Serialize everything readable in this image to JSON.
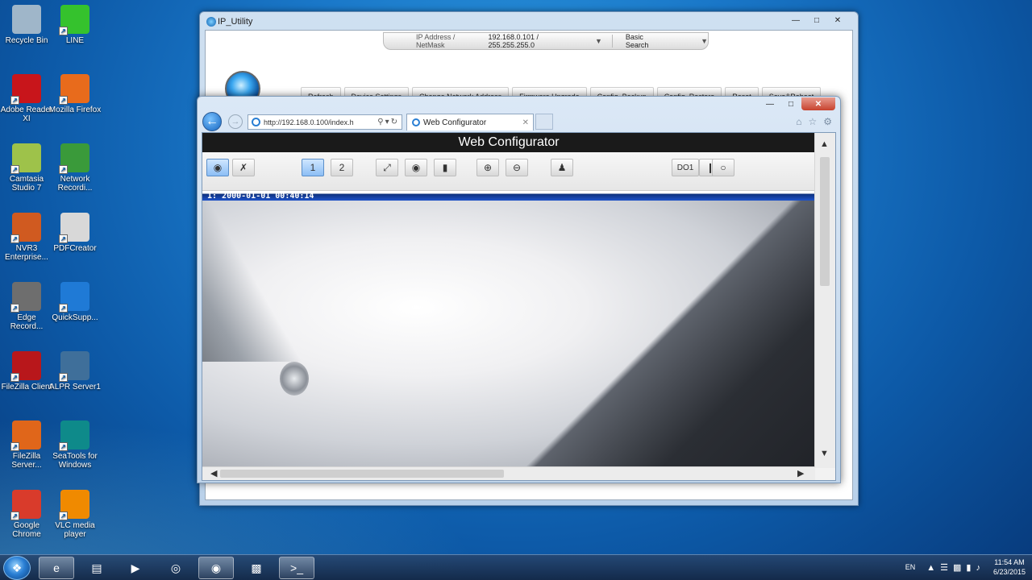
{
  "desktop": {
    "icons": [
      {
        "label": "Recycle Bin",
        "icon": "recycle-bin-icon",
        "color": "#9fb6c9"
      },
      {
        "label": "LINE",
        "icon": "line-icon",
        "color": "#35c22d"
      },
      {
        "label": "Adobe Reader XI",
        "icon": "adobe-reader-icon",
        "color": "#c8151b"
      },
      {
        "label": "Mozilla Firefox",
        "icon": "firefox-icon",
        "color": "#e86b1c"
      },
      {
        "label": "Camtasia Studio 7",
        "icon": "camtasia-icon",
        "color": "#9ec24a"
      },
      {
        "label": "Network Recordi...",
        "icon": "network-recorder-icon",
        "color": "#3a9a3a"
      },
      {
        "label": "NVR3 Enterprise...",
        "icon": "nvr3-icon",
        "color": "#d05a20"
      },
      {
        "label": "PDFCreator",
        "icon": "pdfcreator-icon",
        "color": "#d8d8d8"
      },
      {
        "label": "Edge Record...",
        "icon": "edge-recorder-icon",
        "color": "#6e6e6e"
      },
      {
        "label": "QuickSupp...",
        "icon": "teamviewer-icon",
        "color": "#1f7ad6"
      },
      {
        "label": "FileZilla Client",
        "icon": "filezilla-client-icon",
        "color": "#b8171b"
      },
      {
        "label": "ALPR Server1",
        "icon": "alpr-server-icon",
        "color": "#3f6f9a"
      },
      {
        "label": "FileZilla Server...",
        "icon": "filezilla-server-icon",
        "color": "#e0661a"
      },
      {
        "label": "SeaTools for Windows",
        "icon": "seatools-icon",
        "color": "#0e8a8a"
      },
      {
        "label": "Google Chrome",
        "icon": "chrome-icon",
        "color": "#d93b2b"
      },
      {
        "label": "VLC media player",
        "icon": "vlc-icon",
        "color": "#f08a00"
      }
    ]
  },
  "ip_utility": {
    "title": "IP_Utility",
    "ip_label": "IP Address / NetMask",
    "ip_value": "192.168.0.101 / 255.255.255.0",
    "search_mode": "Basic Search",
    "toolbar": [
      "Refresh",
      "Device Settings",
      "Change Network Address",
      "Firmware Upgrade",
      "Config. Backup",
      "Config. Restore",
      "Reset",
      "Save&Reboot"
    ]
  },
  "browser": {
    "address": "http://192.168.0.100/index.h",
    "tab_title": "Web Configurator",
    "page": {
      "header": "Web Configurator",
      "do_label": "DO1",
      "timestamp": "1:  2000-01-01 00:40:14"
    }
  },
  "taskbar": {
    "lang": "EN",
    "time": "11:54 AM",
    "date": "6/23/2015"
  },
  "colors": {
    "accent": "#1e52c9",
    "header_bg": "#1a1a1a",
    "close_red": "#c7422e"
  }
}
